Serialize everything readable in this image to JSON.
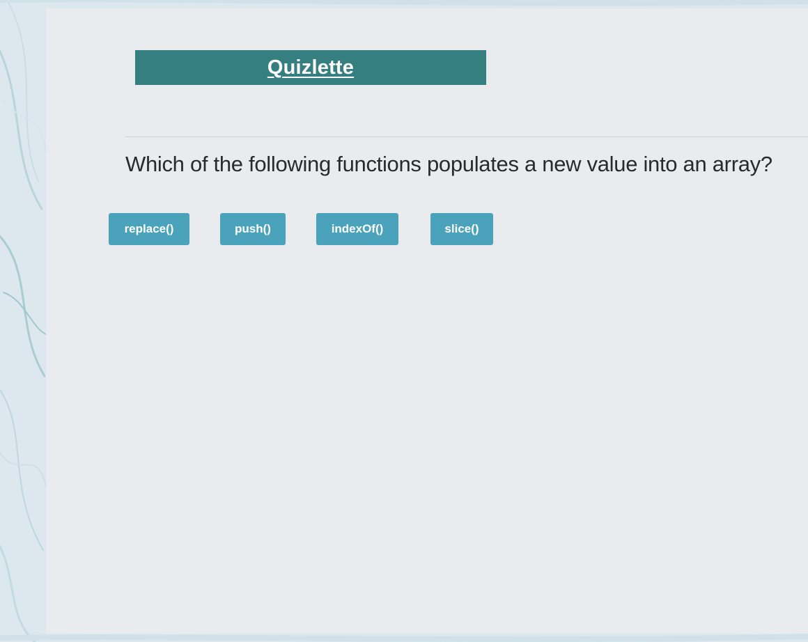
{
  "app": {
    "title": "Quizlette"
  },
  "question": {
    "text": "Which of the following functions populates a new value into an array?"
  },
  "answers": [
    {
      "label": "replace()"
    },
    {
      "label": "push()"
    },
    {
      "label": "indexOf()"
    },
    {
      "label": "slice()"
    }
  ],
  "colors": {
    "title_bar": "#357f80",
    "button": "#4ba3bb",
    "card": "#eaebef",
    "question_text": "#2a2a2e"
  }
}
